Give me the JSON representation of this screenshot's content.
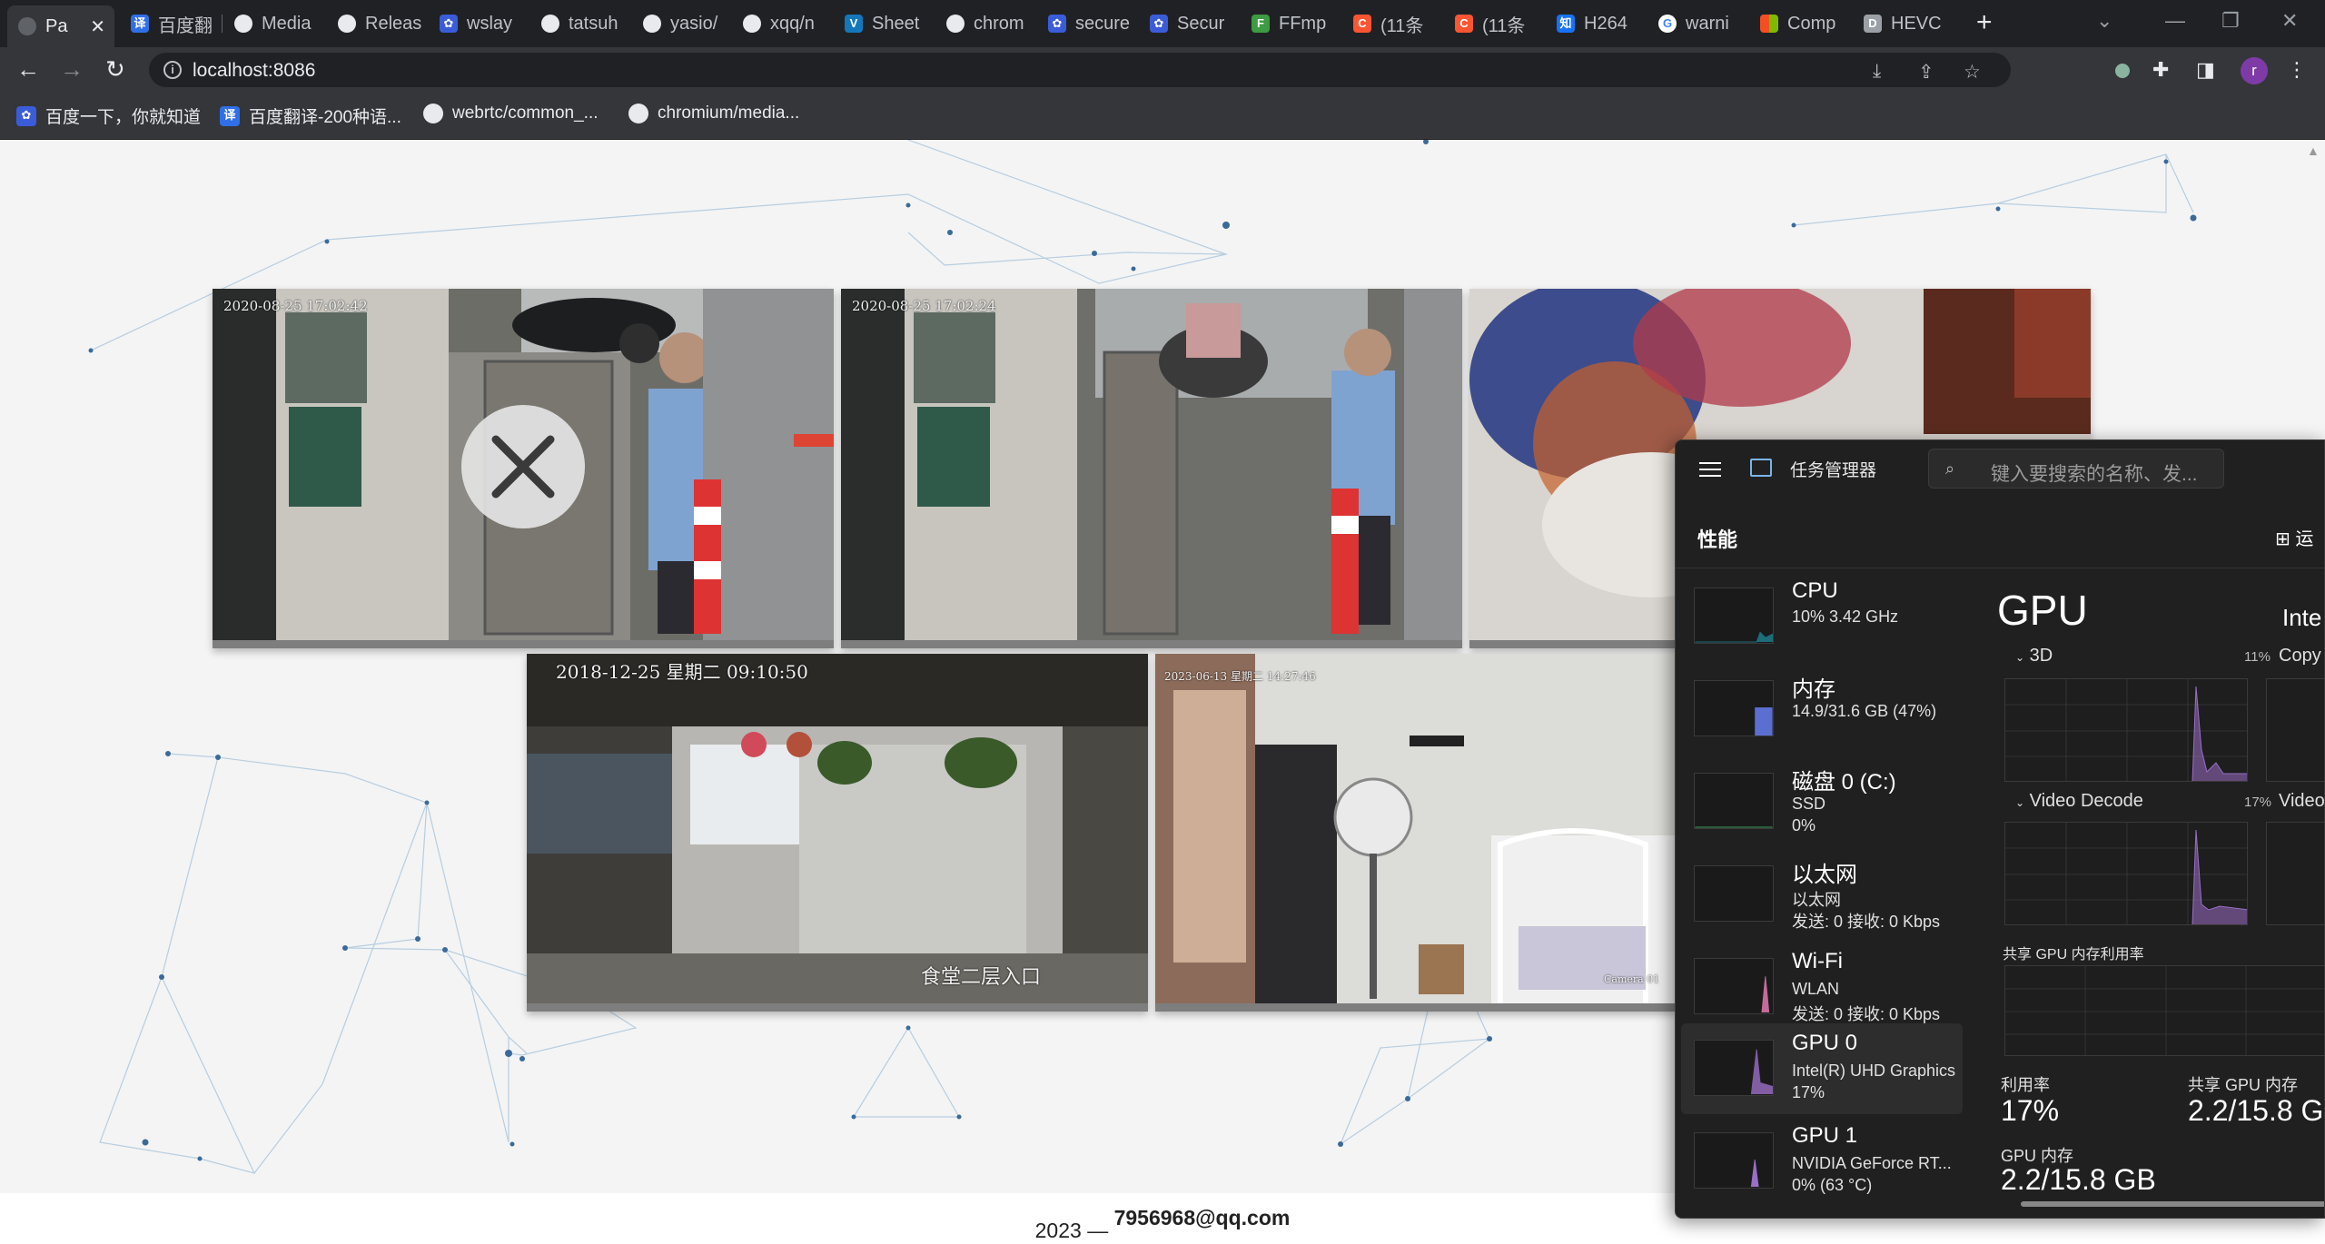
{
  "browser": {
    "tabs": [
      {
        "label": "Pa",
        "icon": "globe-icon",
        "active": true
      },
      {
        "label": "百度翻",
        "icon": "baidu-translate-icon"
      },
      {
        "label": "Media",
        "icon": "github-icon"
      },
      {
        "label": "Releas",
        "icon": "github-icon"
      },
      {
        "label": "wslay",
        "icon": "baidu-icon"
      },
      {
        "label": "tatsuh",
        "icon": "github-icon"
      },
      {
        "label": "yasio/",
        "icon": "github-icon"
      },
      {
        "label": "xqq/n",
        "icon": "github-icon"
      },
      {
        "label": "Sheet",
        "icon": "vscode-icon"
      },
      {
        "label": "chrom",
        "icon": "github-icon"
      },
      {
        "label": "secure",
        "icon": "baidu-icon"
      },
      {
        "label": "Secur",
        "icon": "baidu-icon"
      },
      {
        "label": "FFmp",
        "icon": "ffmpeg-icon"
      },
      {
        "label": "(11条",
        "icon": "csdn-icon"
      },
      {
        "label": "(11条",
        "icon": "csdn-icon"
      },
      {
        "label": "H264",
        "icon": "zhihu-icon"
      },
      {
        "label": "warni",
        "icon": "google-icon"
      },
      {
        "label": "Comp",
        "icon": "microsoft-icon"
      },
      {
        "label": "HEVC",
        "icon": "hevc-icon"
      }
    ],
    "tab_close": "✕",
    "new_tab": "+",
    "url": "localhost:8086",
    "bookmarks": [
      {
        "label": "百度一下，你就知道",
        "icon": "baidu-icon"
      },
      {
        "label": "百度翻译-200种语...",
        "icon": "baidu-translate-icon"
      },
      {
        "label": "webrtc/common_...",
        "icon": "github-icon"
      },
      {
        "label": "chromium/media...",
        "icon": "github-icon"
      }
    ],
    "profile_initial": "r"
  },
  "videos": [
    {
      "timestamp": "2020-08-25 17:02:42",
      "has_close_overlay": true
    },
    {
      "timestamp": "2020-08-25 17:02:24",
      "has_close_overlay": false
    },
    {
      "timestamp": "",
      "has_close_overlay": false
    },
    {
      "timestamp": "2018-12-25 星期二 09:10:50",
      "caption": "食堂二层入口"
    },
    {
      "timestamp": "2023-06-13 星期二 14:27:46",
      "caption": "Camera 01"
    }
  ],
  "footer": {
    "year": "2023 —",
    "email": "7956968@qq.com"
  },
  "task_manager": {
    "app_title": "任务管理器",
    "search_placeholder": "键入要搜索的名称、发...",
    "section": "性能",
    "run_task_label": "运",
    "items": [
      {
        "name": "CPU",
        "line1": "10% 3.42 GHz",
        "line2": ""
      },
      {
        "name": "内存",
        "line1": "14.9/31.6 GB (47%)",
        "line2": ""
      },
      {
        "name": "磁盘 0 (C:)",
        "line1": "SSD",
        "line2": "0%"
      },
      {
        "name": "以太网",
        "line1": "以太网",
        "line2": "发送: 0 接收: 0 Kbps"
      },
      {
        "name": "Wi-Fi",
        "line1": "WLAN",
        "line2": "发送: 0 接收: 0 Kbps"
      },
      {
        "name": "GPU 0",
        "line1": "Intel(R) UHD Graphics",
        "line2": "17%",
        "selected": true
      },
      {
        "name": "GPU 1",
        "line1": "NVIDIA GeForce RT...",
        "line2": "0% (63 °C)"
      }
    ],
    "gpu_title": "GPU",
    "gpu_model": "Inte",
    "engines": [
      {
        "label": "3D",
        "pct": "11%"
      },
      {
        "label": "Copy",
        "pct": ""
      },
      {
        "label": "Video Decode",
        "pct": "17%"
      },
      {
        "label": "Video",
        "pct": ""
      }
    ],
    "shared_mem_label": "共享 GPU 内存利用率",
    "stats": {
      "util_label": "利用率",
      "util_value": "17%",
      "shared_label": "共享 GPU 内存",
      "shared_value": "2.2/15.8 G",
      "gpumem_label": "GPU 内存",
      "gpumem_value": "2.2/15.8 GB"
    },
    "colors": {
      "gpu_graph": "#9b6ec7",
      "cpu_graph": "#1ea5b8",
      "mem_graph": "#5b6fd1",
      "wifi_graph": "#c46b9c"
    }
  }
}
